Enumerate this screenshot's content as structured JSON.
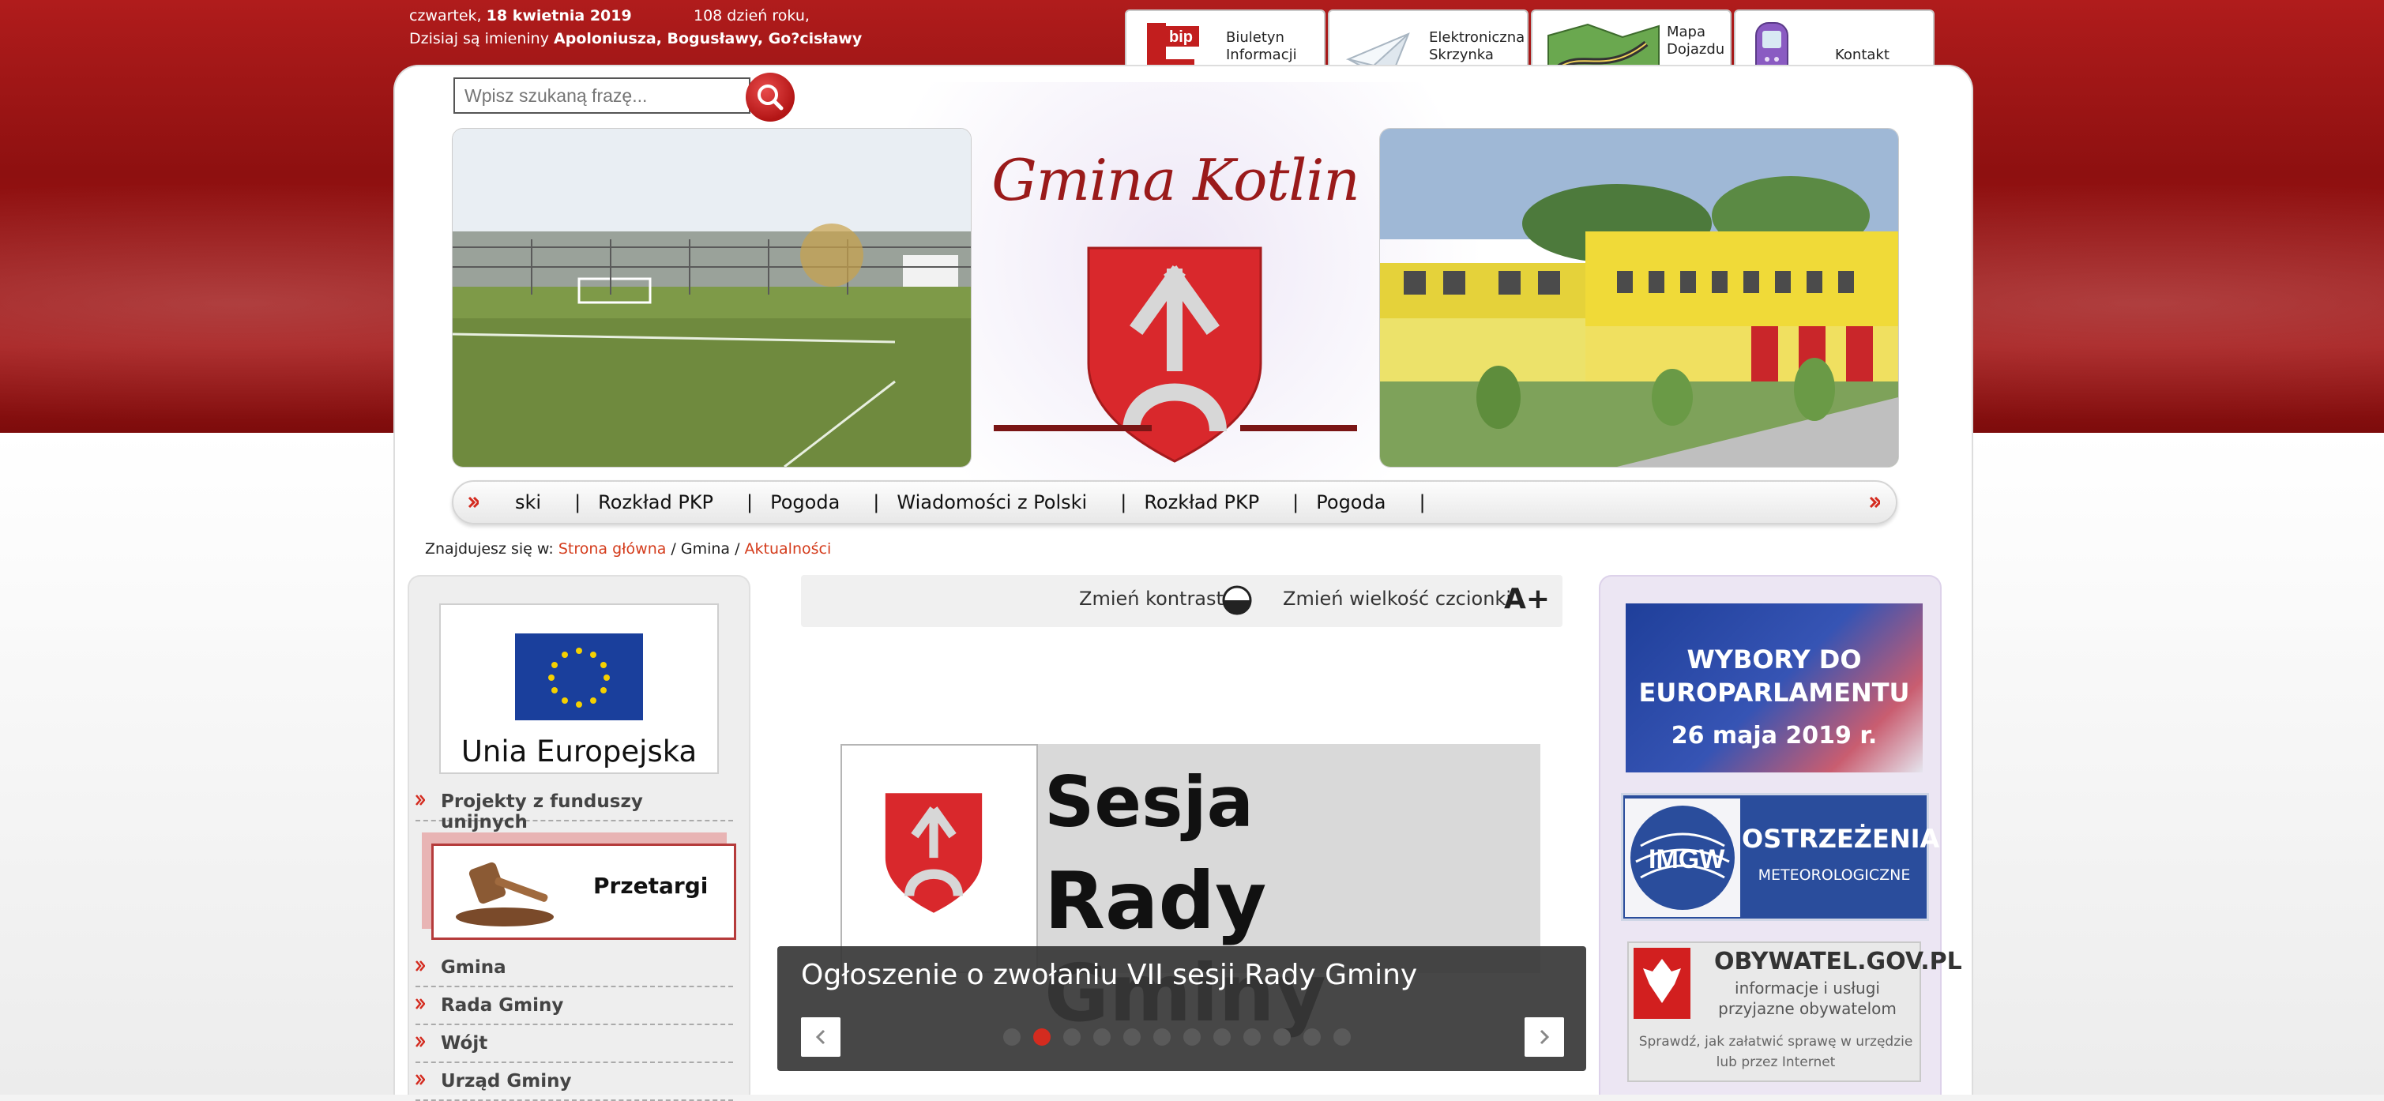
{
  "header": {
    "date_prefix": "czwartek, ",
    "date_bold": "18 kwietnia 2019",
    "day_number": "108 dzień roku,",
    "names_prefix": "Dzisiaj są imieniny ",
    "names_bold": "Apoloniusza, Bogusławy, Go?cisławy"
  },
  "quick_links": [
    {
      "label": "Biuletyn\nInformacji\nPublicznej",
      "icon": "bip-icon"
    },
    {
      "label": "Elektroniczna\nSkrzynka\nPodawcza",
      "icon": "envelope-icon"
    },
    {
      "label": "Mapa\nDojazdu",
      "icon": "map-icon"
    },
    {
      "label": "Kontakt",
      "icon": "phone-icon"
    }
  ],
  "bip_logo_text": "bip",
  "search": {
    "placeholder": "Wpisz szukaną frazę..."
  },
  "site_title": "Gmina Kotlin",
  "ticker": {
    "items": [
      "ski",
      "Rozkład PKP",
      "Pogoda",
      "Wiadomości z Polski",
      "Rozkład PKP",
      "Pogoda"
    ],
    "separator": "|"
  },
  "breadcrumb": {
    "prefix": "Znajdujesz się w: ",
    "home": "Strona główna",
    "sep": " / ",
    "mid": "Gmina",
    "current": "Aktualności"
  },
  "left_sidebar": {
    "eu_label": "Unia Europejska",
    "items": [
      "Projekty z funduszy unijnych",
      "Gmina",
      "Rada Gminy",
      "Wójt",
      "Urząd Gminy"
    ],
    "przetargi": "Przetargi"
  },
  "accessibility": {
    "contrast": "Zmień kontrast",
    "font_size": "Zmień wielkość czcionki",
    "font_icon_text": "A+"
  },
  "slider": {
    "title_line1": "Sesja",
    "title_line2": "Rady Gminy",
    "caption": "Ogłoszenie o zwołaniu VII sesji Rady Gminy",
    "dots": 12,
    "active_dot": 2
  },
  "right_sidebar": {
    "euro_title": "WYBORY DO EUROPARLAMENTU",
    "euro_date": "26 maja 2019 r.",
    "imgw_logo": "IMGW",
    "imgw_title": "OSTRZEŻENIA",
    "imgw_sub": "METEOROLOGICZNE",
    "obywatel_title": "OBYWATEL.GOV.PL",
    "obywatel_sub": "informacje i usługi przyjazne obywatelom",
    "obywatel_note": "Sprawdź, jak załatwić sprawę w urzędzie lub przez Internet"
  },
  "colors": {
    "accent": "#d42b1f",
    "brand_red": "#9a1a1a",
    "link": "#d43c1c"
  }
}
